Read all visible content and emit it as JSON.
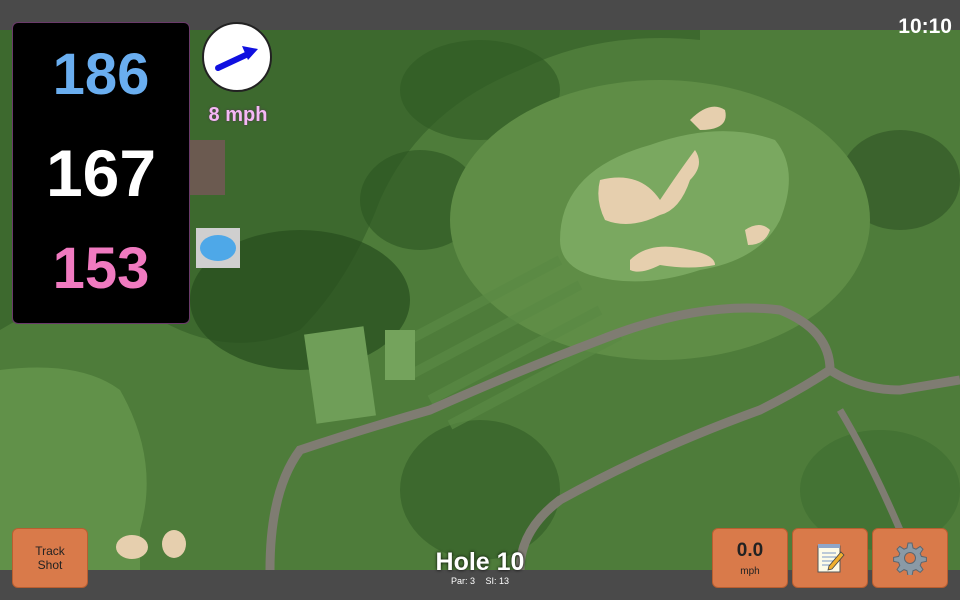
{
  "status_bar": {
    "time": "10:10"
  },
  "distances": {
    "back": "186",
    "middle": "167",
    "front": "153"
  },
  "wind": {
    "speed": "8 mph",
    "arrow_color": "#1010e0"
  },
  "buttons": {
    "track_shot_line1": "Track",
    "track_shot_line2": "Shot",
    "speed_value": "0.0",
    "speed_unit": "mph",
    "notes_icon": "notepad-icon",
    "settings_icon": "gear-icon"
  },
  "hole": {
    "title": "Hole 10",
    "par": "Par: 3",
    "si": "SI: 13"
  },
  "colors": {
    "back_distance": "#6aaef0",
    "middle_distance": "#ffffff",
    "front_distance": "#f07ac0",
    "button": "#d97a4a",
    "bar": "#4a4a4a"
  }
}
